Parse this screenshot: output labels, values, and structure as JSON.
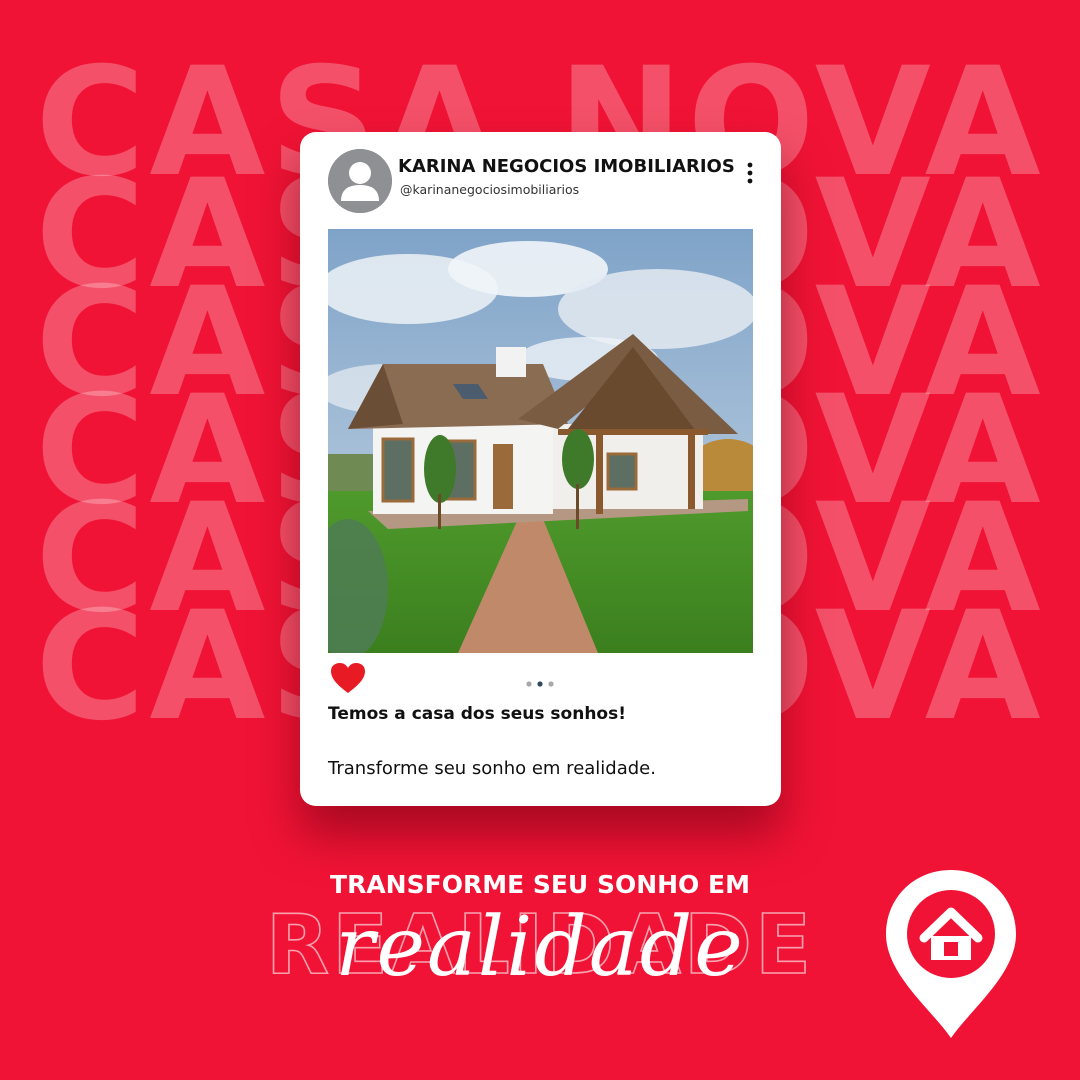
{
  "background": {
    "color": "#f01335",
    "repeated_word": "CASA NOVA"
  },
  "post": {
    "display_name": "KARINA NEGOCIOS IMOBILIARIOS",
    "handle": "@karinanegociosimobiliarios",
    "avatar_icon": "user-silhouette-icon",
    "more_icon": "vertical-dots-icon",
    "photo": "house-photo",
    "like_icon": "heart-icon",
    "like_color": "#e81b24",
    "carousel": {
      "count": 3,
      "active": 2,
      "active_color": "#33495d",
      "inactive_color": "#a8a8a8"
    },
    "caption_title": "Temos a casa dos seus sonhos!",
    "caption_body": "Transforme seu sonho em realidade."
  },
  "footer": {
    "tagline": "TRANSFORME SEU SONHO EM",
    "outline_word": "REALIDADE",
    "script_word": "realidade",
    "pin_icon": "location-pin-house-icon"
  }
}
